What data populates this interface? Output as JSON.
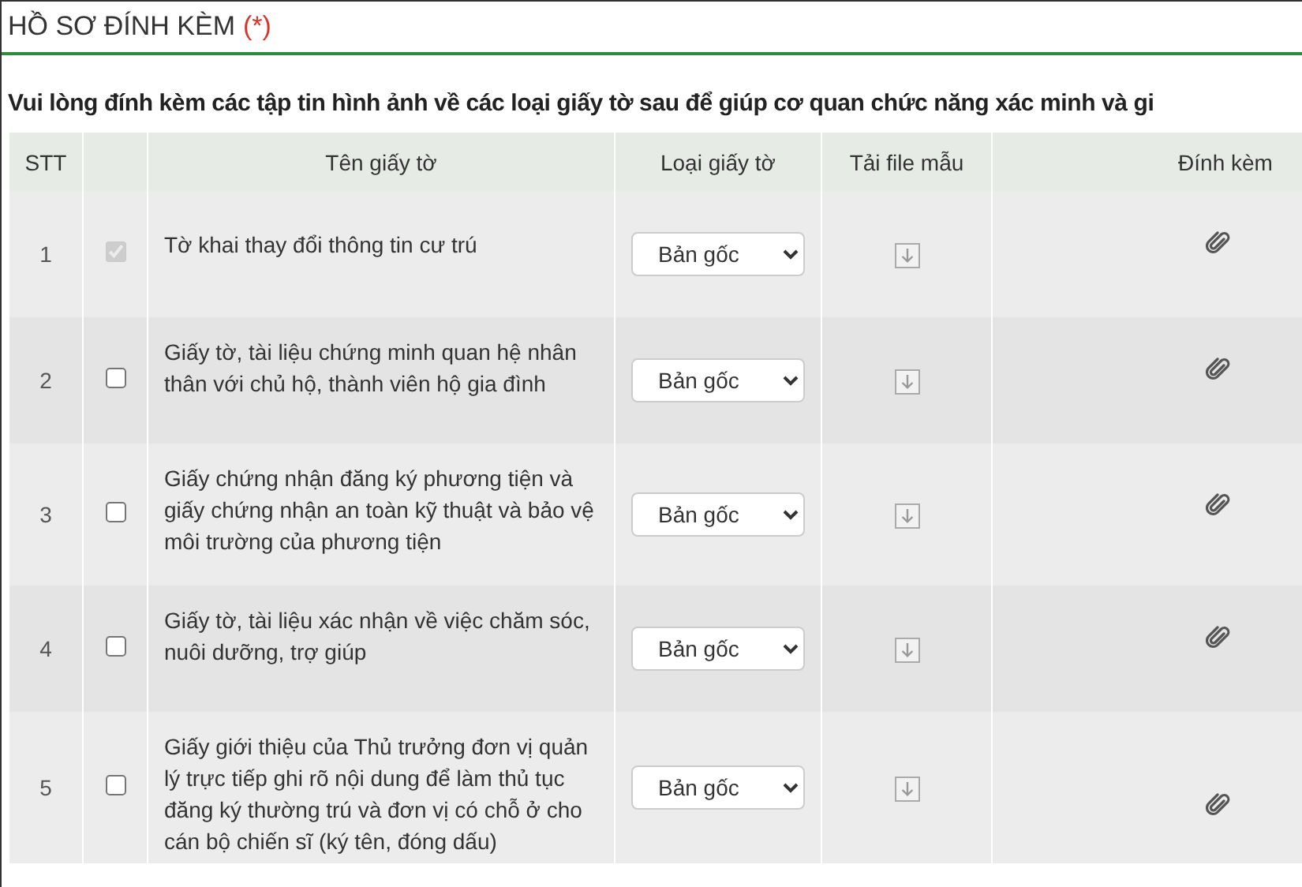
{
  "section": {
    "title": "HỒ SƠ ĐÍNH KÈM",
    "required_mark": "(*)"
  },
  "instruction": "Vui lòng đính kèm các tập tin hình ảnh về các loại giấy tờ sau để giúp cơ quan chức năng xác minh và gi",
  "table": {
    "columns": [
      "STT",
      "Tên giấy tờ",
      "Loại giấy tờ",
      "Tải file mẫu",
      "Đính kèm"
    ],
    "rows": [
      {
        "index": "1",
        "checked": true,
        "disabled": true,
        "name": "Tờ khai thay đổi thông tin cư trú",
        "type": "Bản gốc"
      },
      {
        "index": "2",
        "checked": false,
        "disabled": false,
        "name": "Giấy tờ, tài liệu chứng minh quan hệ nhân thân với chủ hộ, thành viên hộ gia đình",
        "type": "Bản gốc"
      },
      {
        "index": "3",
        "checked": false,
        "disabled": false,
        "name": "Giấy chứng nhận đăng ký phương tiện và giấy chứng nhận an toàn kỹ thuật và bảo vệ môi trường của phương tiện",
        "type": "Bản gốc"
      },
      {
        "index": "4",
        "checked": false,
        "disabled": false,
        "name": "Giấy tờ, tài liệu xác nhận về việc chăm sóc, nuôi dưỡng, trợ giúp",
        "type": "Bản gốc"
      },
      {
        "index": "5",
        "checked": false,
        "disabled": false,
        "name": "Giấy giới thiệu của Thủ trưởng đơn vị quản lý trực tiếp ghi rõ nội dung để làm thủ tục đăng ký thường trú và đơn vị có chỗ ở cho cán bộ chiến sĩ (ký tên, đóng dấu)",
        "type": "Bản gốc"
      }
    ]
  }
}
